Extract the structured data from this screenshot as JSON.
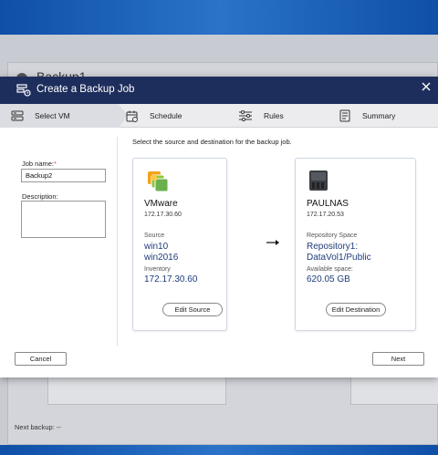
{
  "background": {
    "page_title": "Backup1",
    "next_backup": "Next backup: --"
  },
  "modal": {
    "title": "Create a Backup Job",
    "steps": [
      {
        "label": "Select VM",
        "icon": "server-list-icon"
      },
      {
        "label": "Schedule",
        "icon": "calendar-icon"
      },
      {
        "label": "Rules",
        "icon": "sliders-icon"
      },
      {
        "label": "Summary",
        "icon": "document-icon"
      }
    ],
    "form": {
      "job_name_label": "Job name:",
      "required_mark": "*",
      "job_name_value": "Backup2",
      "description_label": "Description:",
      "description_value": ""
    },
    "instruction": "Select the source and destination for the backup job.",
    "source": {
      "name": "VMware",
      "ip": "172.17.30.60",
      "source_label": "Source",
      "source_values": [
        "win10",
        "win2016"
      ],
      "inventory_label": "Inventory",
      "inventory_value": "172.17.30.60",
      "button": "Edit Source"
    },
    "destination": {
      "name": "PAULNAS",
      "ip": "172.17.20.53",
      "repo_label": "Repository Space",
      "repo_values": [
        "Repository1:",
        "DataVol1/Public"
      ],
      "space_label": "Available space:",
      "space_value": "620.05 GB",
      "button": "Edit Destination"
    },
    "cancel": "Cancel",
    "next": "Next"
  },
  "colors": {
    "header": "#1e2e5c",
    "value_text": "#1e3c7a",
    "required": "#d9534f",
    "vmware_orange": "#f2a21c",
    "vmware_green": "#6ab04c"
  }
}
